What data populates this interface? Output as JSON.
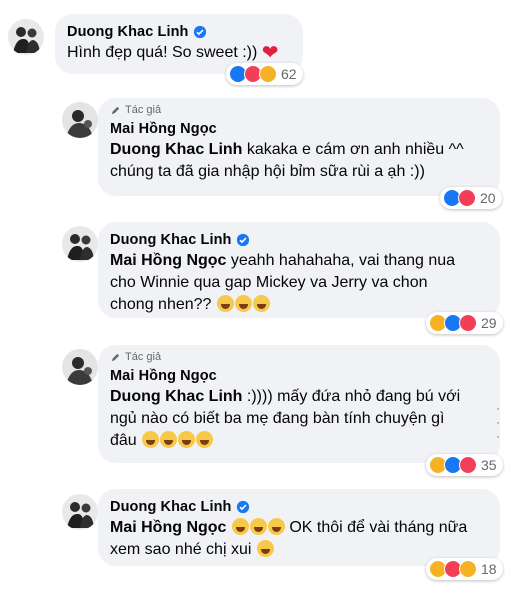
{
  "comments": [
    {
      "author": "Duong Khac Linh",
      "verified": true,
      "badge": "",
      "mention": "",
      "lines": [
        "Hình đẹp quá! So sweet :))"
      ],
      "reactions": [
        "like",
        "love",
        "haha"
      ],
      "count": "62"
    },
    {
      "author": "Mai Hồng Ngọc",
      "verified": false,
      "badge": "Tác giả",
      "mention": "Duong Khac Linh",
      "lines": [
        " kakaka e cám ơn anh nhiều ^^",
        "chúng ta đã gia nhập hội bỉm sữa rùi a ạh :))"
      ],
      "reactions": [
        "like",
        "love"
      ],
      "count": "20"
    },
    {
      "author": "Duong Khac Linh",
      "verified": true,
      "badge": "",
      "mention": "Mai Hồng Ngọc",
      "lines": [
        " yeahh hahahaha, vai thang nua",
        "cho Winnie qua gap Mickey va Jerry va chon",
        "chong nhen??"
      ],
      "reactions": [
        "haha",
        "like",
        "love"
      ],
      "count": "29"
    },
    {
      "author": "Mai Hồng Ngọc",
      "verified": false,
      "badge": "Tác giả",
      "mention": "Duong Khac Linh",
      "lines": [
        " :)))) mấy đứa nhỏ đang bú với",
        "ngủ nào có biết ba mẹ đang bàn tính chuyện gì",
        "đâu"
      ],
      "reactions": [
        "haha",
        "like",
        "love"
      ],
      "count": "35"
    },
    {
      "author": "Duong Khac Linh",
      "verified": true,
      "badge": "",
      "mention": "Mai Hồng Ngọc",
      "lines": [
        " OK thôi để vài tháng nữa",
        "xem sao nhé chị xui"
      ],
      "reactions": [
        "haha",
        "love",
        "wow"
      ],
      "count": "18"
    }
  ],
  "colors": {
    "like": "#1877f2",
    "love": "#f33e58",
    "haha": "#f7b125",
    "wow": "#f7b125",
    "bubble": "#f0f2f5",
    "verified": "#1877f2"
  }
}
